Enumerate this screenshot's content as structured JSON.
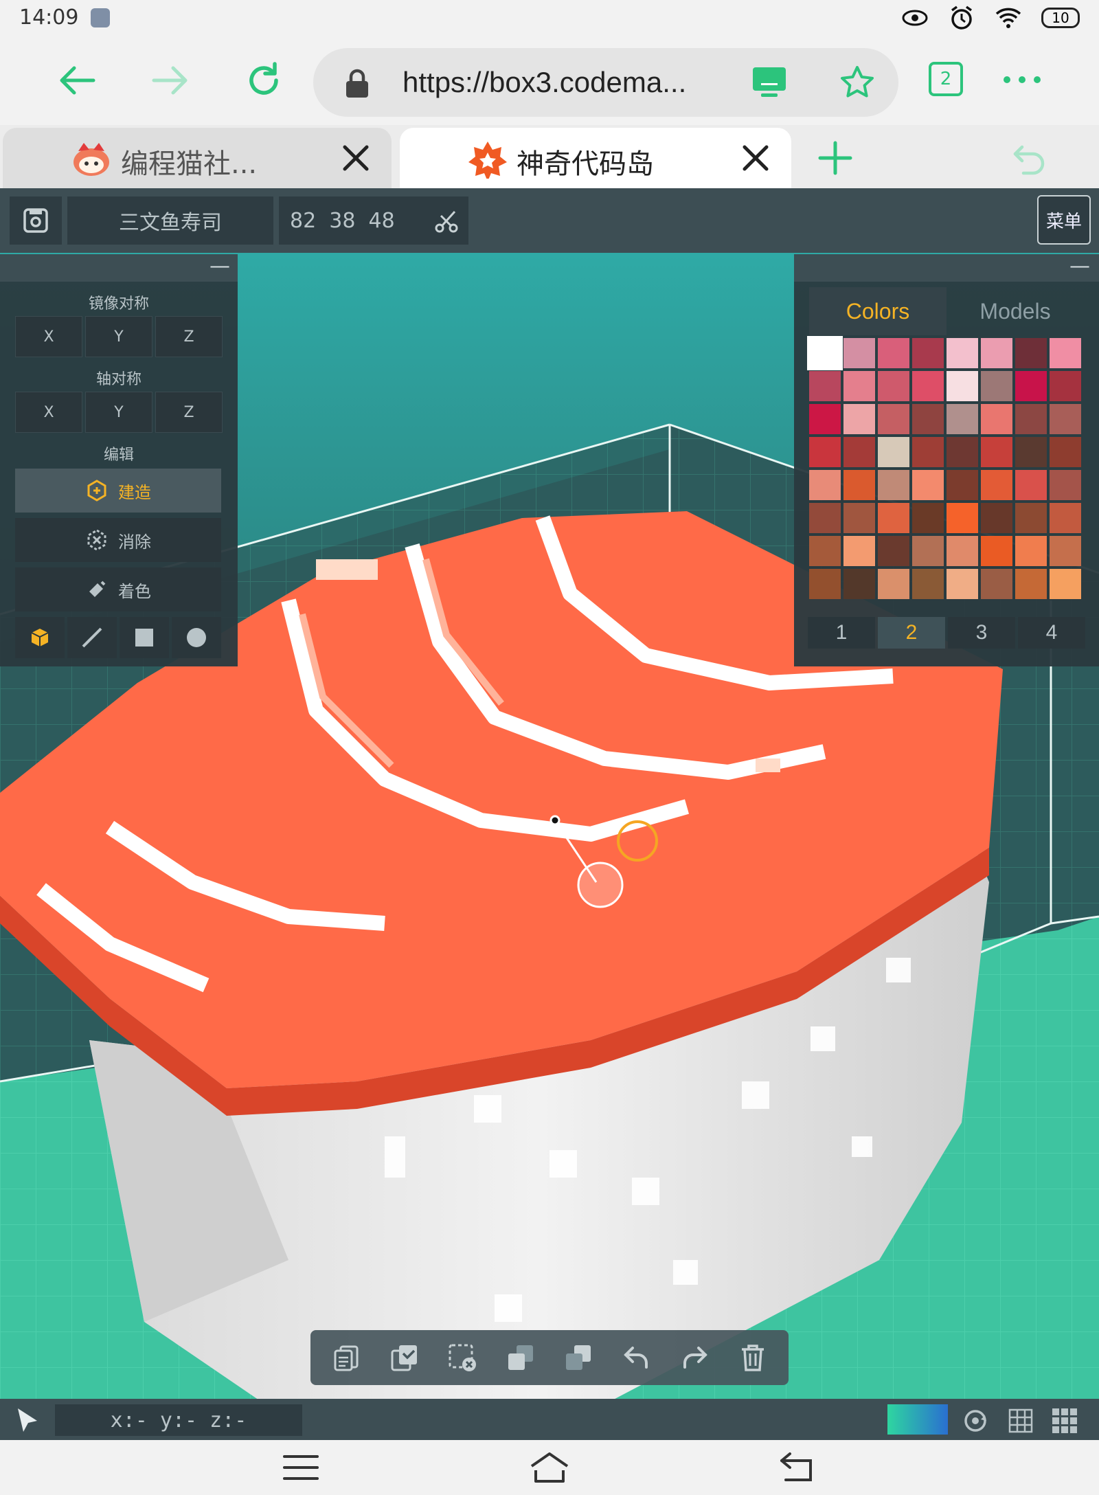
{
  "status_bar": {
    "time": "14:09",
    "icons": [
      "scissors-app-icon",
      "eye-icon",
      "alarm-icon",
      "wifi-icon"
    ],
    "battery": "10"
  },
  "browser": {
    "url": "https://box3.codema...",
    "tab_count": "2",
    "tabs": [
      {
        "title": "编程猫社...",
        "icon": "codemao-logo-icon",
        "active": false
      },
      {
        "title": "神奇代码岛",
        "icon": "code-island-logo-icon",
        "active": true
      }
    ],
    "accent": "#2cc47c"
  },
  "editor": {
    "model_name": "三文鱼寿司",
    "dimensions": "82  38  48",
    "menu_label": "菜单",
    "left_panel": {
      "mirror_label": "镜像对称",
      "mirror_axes": [
        "X",
        "Y",
        "Z"
      ],
      "axis_label": "轴对称",
      "axis_axes": [
        "X",
        "Y",
        "Z"
      ],
      "edit_label": "编辑",
      "tools": [
        {
          "label": "建造",
          "icon": "build-icon",
          "active": true
        },
        {
          "label": "消除",
          "icon": "erase-icon",
          "active": false
        },
        {
          "label": "着色",
          "icon": "paint-icon",
          "active": false
        }
      ],
      "shapes": [
        "cube-icon",
        "line-icon",
        "square-icon",
        "sphere-icon"
      ]
    },
    "palette": {
      "tabs": [
        {
          "label": "Colors",
          "active": true
        },
        {
          "label": "Models",
          "active": false
        }
      ],
      "colors": [
        "#ffffff",
        "#d48fa3",
        "#d95f7a",
        "#a83a4d",
        "#f3c0cd",
        "#eb9db0",
        "#6e2f38",
        "#f08ea4",
        "#b8475e",
        "#e47f8d",
        "#cf5a6c",
        "#de4e67",
        "#f7dfe2",
        "#9c7876",
        "#c8134a",
        "#a5323f",
        "#cc1745",
        "#eda5a7",
        "#c55f63",
        "#8f4440",
        "#b0908d",
        "#e9766f",
        "#8c4743",
        "#a85e58",
        "#c9353d",
        "#a43b38",
        "#d7c9b8",
        "#9e3e36",
        "#6e3832",
        "#c6403a",
        "#5a3a30",
        "#8e3d2f",
        "#e88b78",
        "#da5a2e",
        "#c08a77",
        "#f38a6d",
        "#7c3c2d",
        "#e35b36",
        "#d9514b",
        "#a4544a",
        "#934a3a",
        "#a0563f",
        "#df6340",
        "#6a3a27",
        "#f5622a",
        "#67382a",
        "#8c4a32",
        "#c25a3f",
        "#a55a3a",
        "#f39b70",
        "#6a3a2e",
        "#b27055",
        "#e08a6a",
        "#ea5b24",
        "#f07d4e",
        "#c56f4c",
        "#93502e",
        "#53382a",
        "#da906b",
        "#8a5a36",
        "#f0ad86",
        "#9a5d45",
        "#c56936",
        "#f5a060"
      ],
      "pages": [
        "1",
        "2",
        "3",
        "4"
      ],
      "active_page": "2"
    },
    "action_bar": [
      "copy-icon",
      "select-all-icon",
      "deselect-icon",
      "duplicate-icon",
      "merge-icon",
      "undo-icon",
      "redo-icon",
      "delete-icon"
    ],
    "coords": "x:- y:- z:-",
    "bottom_icons": [
      "pointer-icon",
      "orbit-icon",
      "grid-icon",
      "dense-grid-icon"
    ],
    "scene_colors": {
      "salmon": "#ff6a48",
      "rice": "#e6e6e6",
      "floor": "#3ec4a0",
      "backwall": "#38aaa8"
    }
  },
  "nav_bar": [
    "menu-icon",
    "home-icon",
    "back-icon"
  ]
}
